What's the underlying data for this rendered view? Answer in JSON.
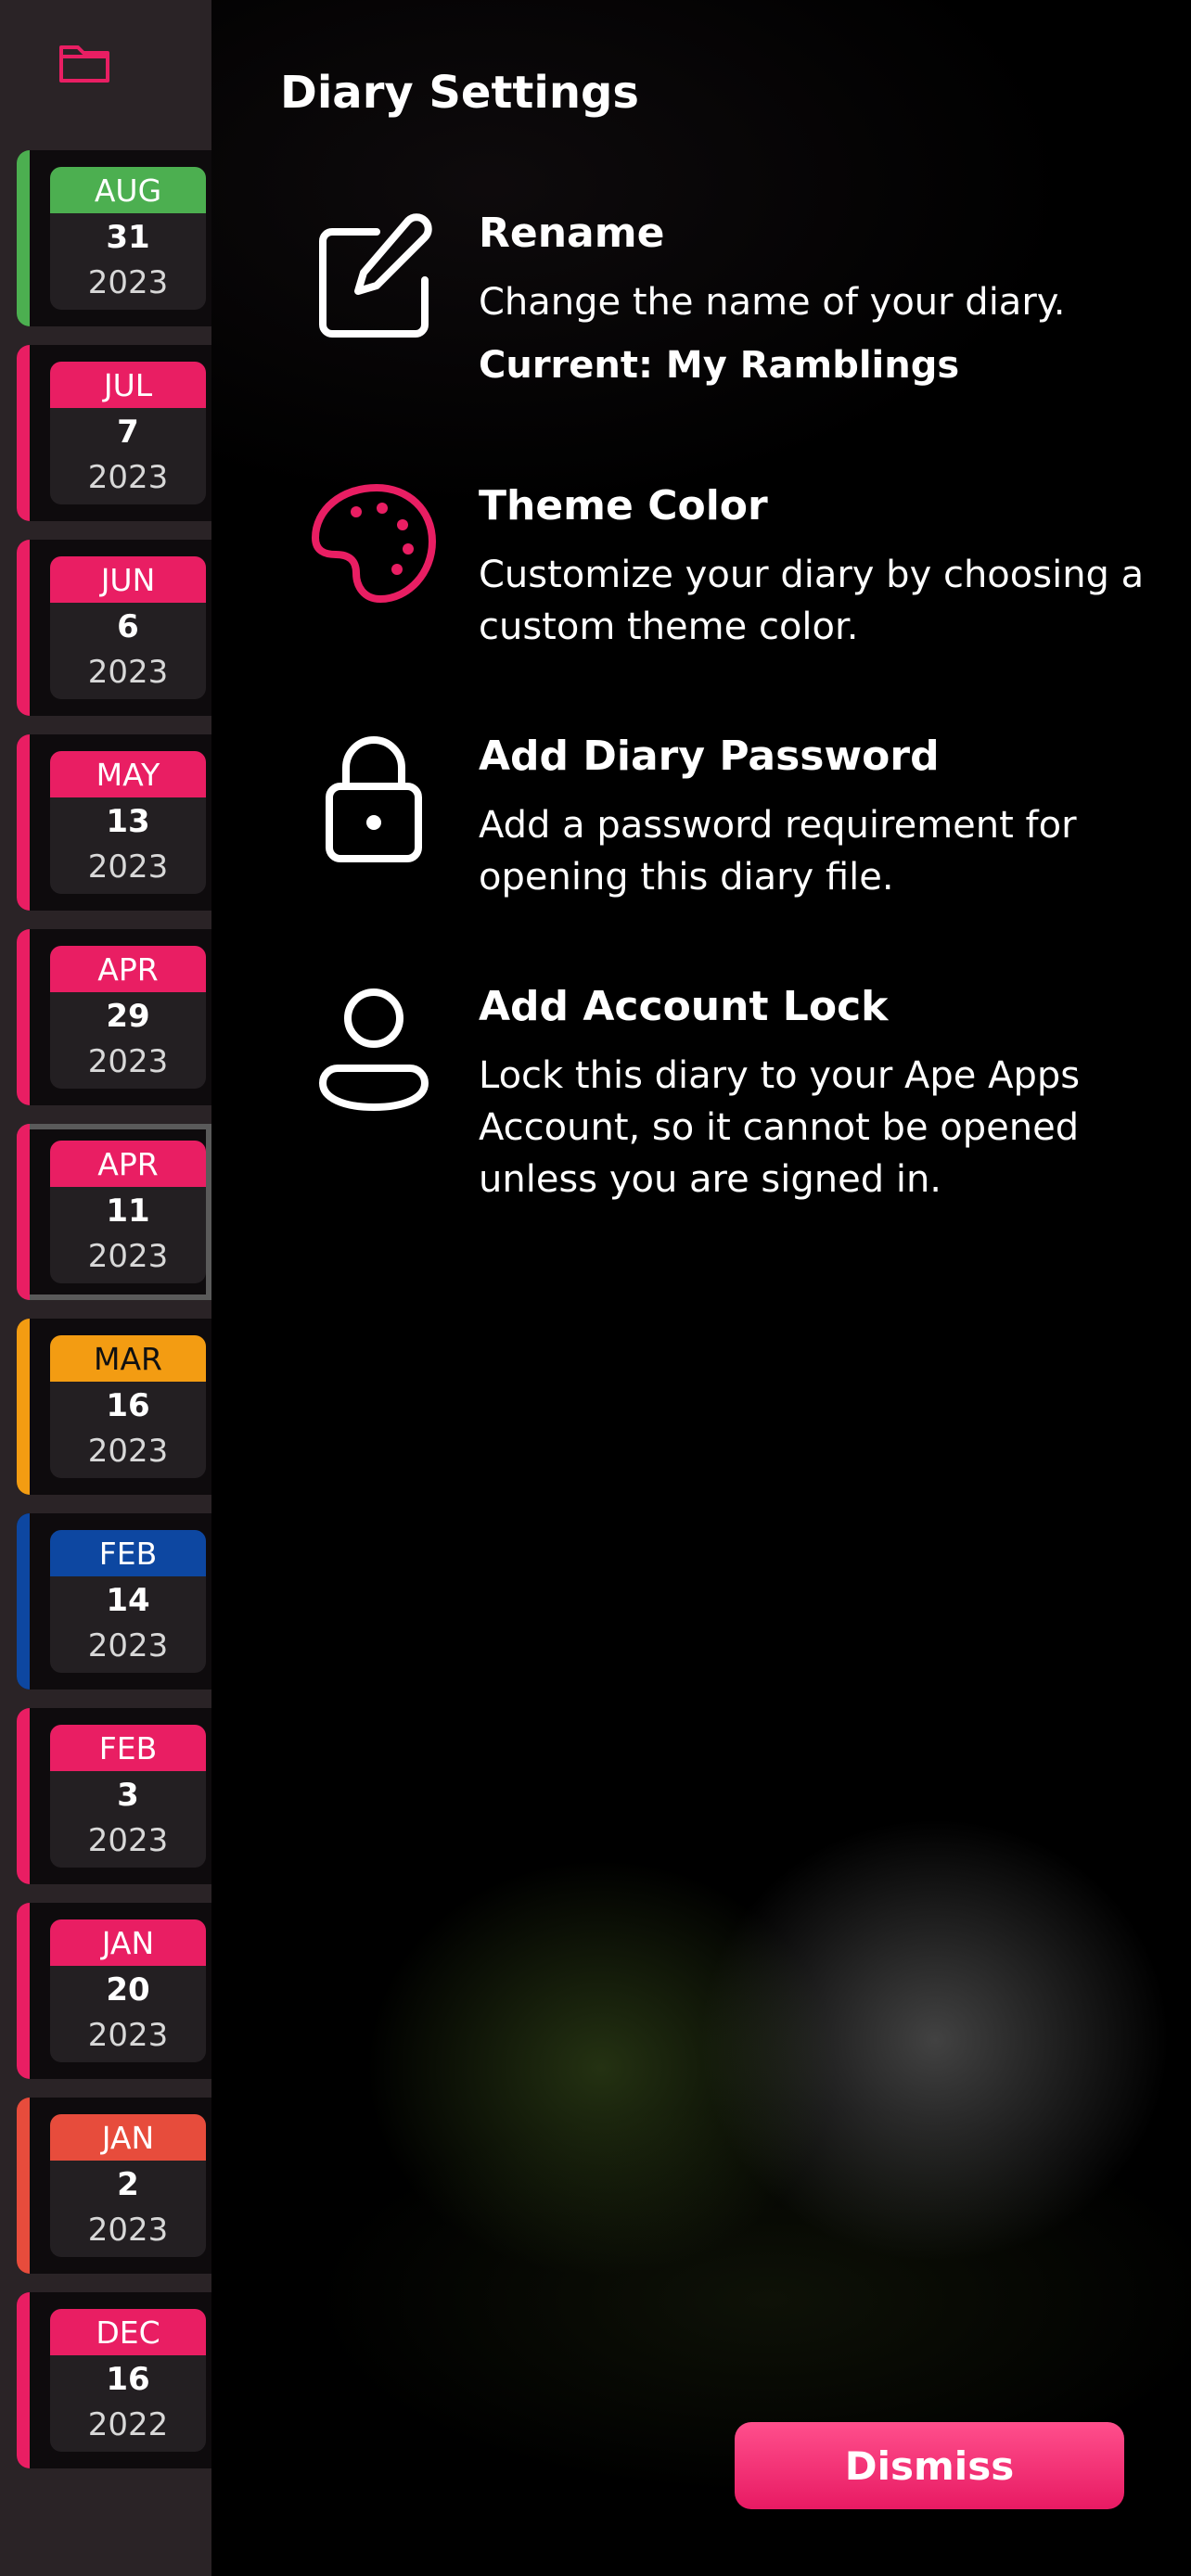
{
  "colors": {
    "accent": "#e91e63",
    "green": "#4caf50",
    "orange": "#f39c12",
    "blue": "#0d47a1",
    "red": "#e74c3c"
  },
  "sidebar": {
    "folder_icon": "folder-icon",
    "entries": [
      {
        "month": "AUG",
        "day": "31",
        "year": "2023",
        "color": "#4caf50"
      },
      {
        "month": "JUL",
        "day": "7",
        "year": "2023",
        "color": "#e91e63"
      },
      {
        "month": "JUN",
        "day": "6",
        "year": "2023",
        "color": "#e91e63"
      },
      {
        "month": "MAY",
        "day": "13",
        "year": "2023",
        "color": "#e91e63"
      },
      {
        "month": "APR",
        "day": "29",
        "year": "2023",
        "color": "#e91e63"
      },
      {
        "month": "APR",
        "day": "11",
        "year": "2023",
        "color": "#e91e63",
        "selected": true
      },
      {
        "month": "MAR",
        "day": "16",
        "year": "2023",
        "color": "#f39c12"
      },
      {
        "month": "FEB",
        "day": "14",
        "year": "2023",
        "color": "#0d47a1"
      },
      {
        "month": "FEB",
        "day": "3",
        "year": "2023",
        "color": "#e91e63"
      },
      {
        "month": "JAN",
        "day": "20",
        "year": "2023",
        "color": "#e91e63"
      },
      {
        "month": "JAN",
        "day": "2",
        "year": "2023",
        "color": "#e74c3c"
      },
      {
        "month": "DEC",
        "day": "16",
        "year": "2022",
        "color": "#e91e63"
      }
    ]
  },
  "settings": {
    "title": "Diary Settings",
    "items": [
      {
        "icon": "edit-icon",
        "heading": "Rename",
        "description": "Change the name of your diary.",
        "current": "Current: My Ramblings"
      },
      {
        "icon": "palette-icon",
        "heading": "Theme Color",
        "description": "Customize your diary by choosing a custom theme color."
      },
      {
        "icon": "lock-icon",
        "heading": "Add Diary Password",
        "description": "Add a password requirement for opening this diary file."
      },
      {
        "icon": "user-icon",
        "heading": "Add Account Lock",
        "description": "Lock this diary to your Ape Apps Account, so it cannot be opened unless you are signed in."
      }
    ],
    "dismiss_label": "Dismiss"
  }
}
